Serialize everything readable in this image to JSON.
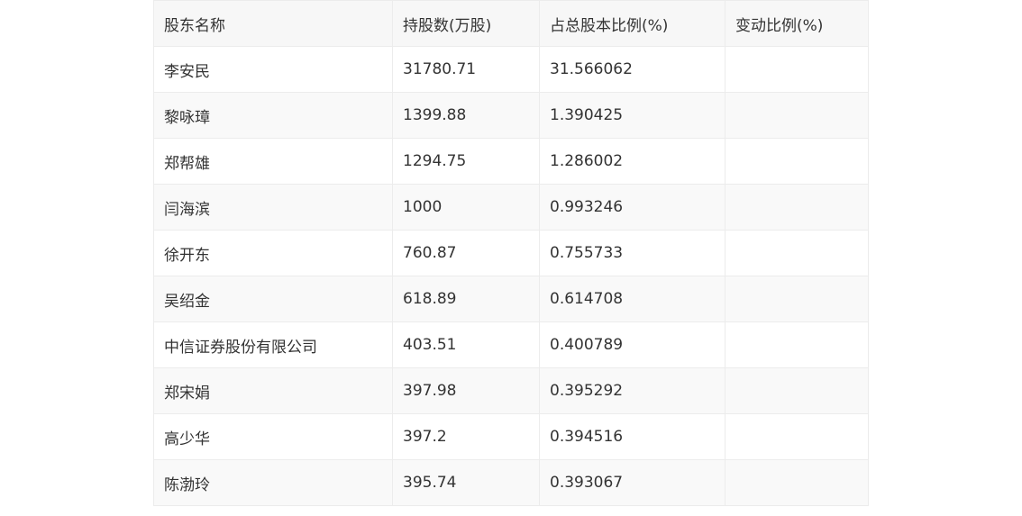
{
  "table": {
    "headers": [
      "股东名称",
      "持股数(万股)",
      "占总股本比例(%)",
      "变动比例(%)"
    ],
    "rows": [
      [
        "李安民",
        "31780.71",
        "31.566062",
        ""
      ],
      [
        "黎咏璋",
        "1399.88",
        "1.390425",
        ""
      ],
      [
        "郑帮雄",
        "1294.75",
        "1.286002",
        ""
      ],
      [
        "闫海滨",
        "1000",
        "0.993246",
        ""
      ],
      [
        "徐开东",
        "760.87",
        "0.755733",
        ""
      ],
      [
        "吴绍金",
        "618.89",
        "0.614708",
        ""
      ],
      [
        "中信证券股份有限公司",
        "403.51",
        "0.400789",
        ""
      ],
      [
        "郑宋娟",
        "397.98",
        "0.395292",
        ""
      ],
      [
        "高少华",
        "397.2",
        "0.394516",
        ""
      ],
      [
        "陈渤玲",
        "395.74",
        "0.393067",
        ""
      ]
    ]
  }
}
